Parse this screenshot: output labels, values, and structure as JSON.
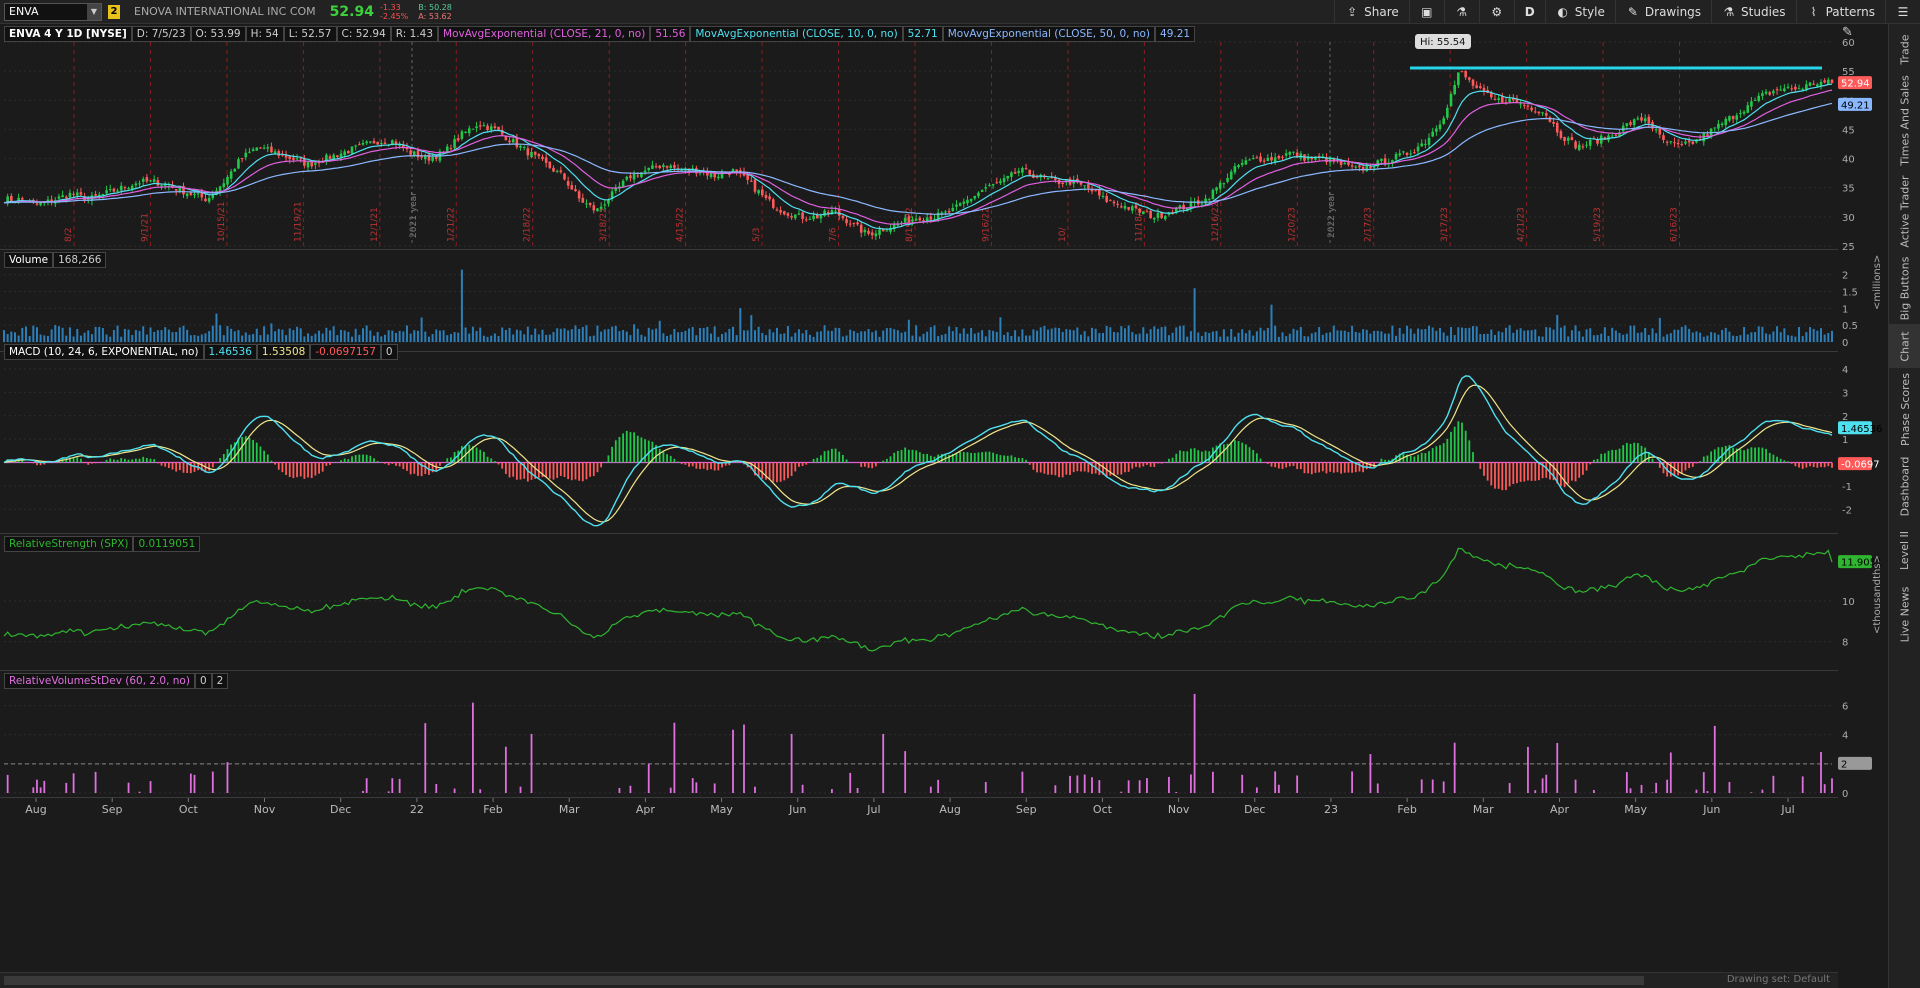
{
  "header": {
    "symbol": "ENVA",
    "link_group": "2",
    "company": "ENOVA INTERNATIONAL INC COM",
    "last": "52.94",
    "change": "-1.33",
    "change_pct": "-2.45%",
    "bid": "B: 50.28",
    "ask": "A: 53.62"
  },
  "toolbar": {
    "share": "Share",
    "period": "D",
    "style": "Style",
    "drawings": "Drawings",
    "studies": "Studies",
    "patterns": "Patterns"
  },
  "price_pane": {
    "title": "ENVA 4 Y 1D [NYSE]",
    "date": "D: 7/5/23",
    "open": "O: 53.99",
    "high": "H: 54",
    "low": "L: 52.57",
    "close": "C: 52.94",
    "range": "R: 1.43",
    "ema21_label": "MovAvgExponential (CLOSE, 21, 0, no)",
    "ema21_val": "51.56",
    "ema10_label": "MovAvgExponential (CLOSE, 10, 0, no)",
    "ema10_val": "52.71",
    "ema50_label": "MovAvgExponential (CLOSE, 50, 0, no)",
    "ema50_val": "49.21",
    "hi_label": "Hi: 55.54",
    "last_tag": "52.94",
    "ema50_tag": "49.21",
    "y_ticks": [
      "60",
      "55",
      "50",
      "45",
      "40",
      "35",
      "30",
      "25"
    ],
    "earnings_dates": [
      "8/2",
      "9/1/21",
      "10/15/21",
      "11/19/21",
      "12/1/21",
      "1/21/22",
      "2/18/22",
      "3/18/22",
      "4/15/22",
      "5/3",
      "7/6",
      "8/19/22",
      "9/16/22",
      "10/",
      "11/18/22",
      "12/16/22",
      "1/20/23",
      "2/17/23",
      "3/17/23",
      "4/21/23",
      "5/19/23",
      "6/16/23"
    ],
    "year_labels": [
      "2021 year",
      "2022 year"
    ]
  },
  "volume_pane": {
    "title": "Volume",
    "value": "168,266",
    "y_ticks": [
      "2",
      "1.5",
      "1",
      "0.5",
      "0"
    ],
    "unit": "<millions>"
  },
  "macd_pane": {
    "title": "MACD (10, 24, 6, EXPONENTIAL, no)",
    "value": "1.46536",
    "avg": "1.53508",
    "diff": "-0.0697157",
    "zero": "0",
    "value_tag": "1.46536",
    "diff_tag": "-0.0697",
    "y_ticks": [
      "4",
      "3",
      "2",
      "1",
      "0",
      "-1",
      "-2"
    ]
  },
  "rs_pane": {
    "title": "RelativeStrength (SPX)",
    "value": "0.0119051",
    "tag": "11.9051",
    "y_ticks": [
      "10",
      "8"
    ],
    "unit": "<thousandths>"
  },
  "rvsd_pane": {
    "title": "RelativeVolumeStDev (60, 2.0, no)",
    "v1": "0",
    "v2": "2",
    "y_ticks": [
      "6",
      "4",
      "2",
      "0"
    ],
    "tag": "2"
  },
  "x_axis": [
    "Aug",
    "Sep",
    "Oct",
    "Nov",
    "Dec",
    "22",
    "Feb",
    "Mar",
    "Apr",
    "May",
    "Jun",
    "Jul",
    "Aug",
    "Sep",
    "Oct",
    "Nov",
    "Dec",
    "23",
    "Feb",
    "Mar",
    "Apr",
    "May",
    "Jun",
    "Jul"
  ],
  "status": {
    "drawing_set": "Drawing set: Default"
  },
  "right_rail": [
    "Trade",
    "Times And Sales",
    "Active Trader",
    "Big Buttons",
    "Chart",
    "Phase Scores",
    "Dashboard",
    "Level II",
    "Live News"
  ],
  "colors": {
    "up": "#22c84a",
    "down": "#ff5a5a",
    "ema10": "#4fe0f0",
    "ema21": "#e060e0",
    "ema50": "#8ab8ff",
    "resistance": "#27d5e8",
    "rs": "#2fb52f",
    "rvsd": "#e070e0"
  },
  "chart_data": {
    "type": "line",
    "x_range": [
      "2021-07",
      "2023-07"
    ],
    "price_ylim": [
      25,
      60
    ],
    "close_series": [
      33,
      33,
      32,
      33,
      34,
      33,
      34,
      35,
      36,
      36,
      35,
      34,
      33,
      36,
      40,
      42,
      41,
      40,
      39,
      40,
      41,
      42,
      43,
      43,
      41,
      40,
      41,
      44,
      46,
      45,
      43,
      41,
      39,
      37,
      33,
      31,
      34,
      37,
      38,
      39,
      38,
      38,
      37,
      38,
      36,
      33,
      31,
      30,
      30,
      31,
      29,
      27,
      28,
      29,
      30,
      30,
      31,
      33,
      35,
      36,
      38,
      37,
      36,
      36,
      35,
      33,
      32,
      31,
      30,
      31,
      32,
      33,
      36,
      39,
      40,
      40,
      41,
      40,
      40,
      39,
      38,
      39,
      40,
      41,
      43,
      47,
      55,
      52,
      50,
      50,
      49,
      48,
      44,
      42,
      43,
      44,
      46,
      47,
      43,
      42,
      43,
      45,
      47,
      49,
      51,
      52,
      52,
      53,
      53
    ],
    "resistance": 55.54,
    "last": 52.94
  }
}
